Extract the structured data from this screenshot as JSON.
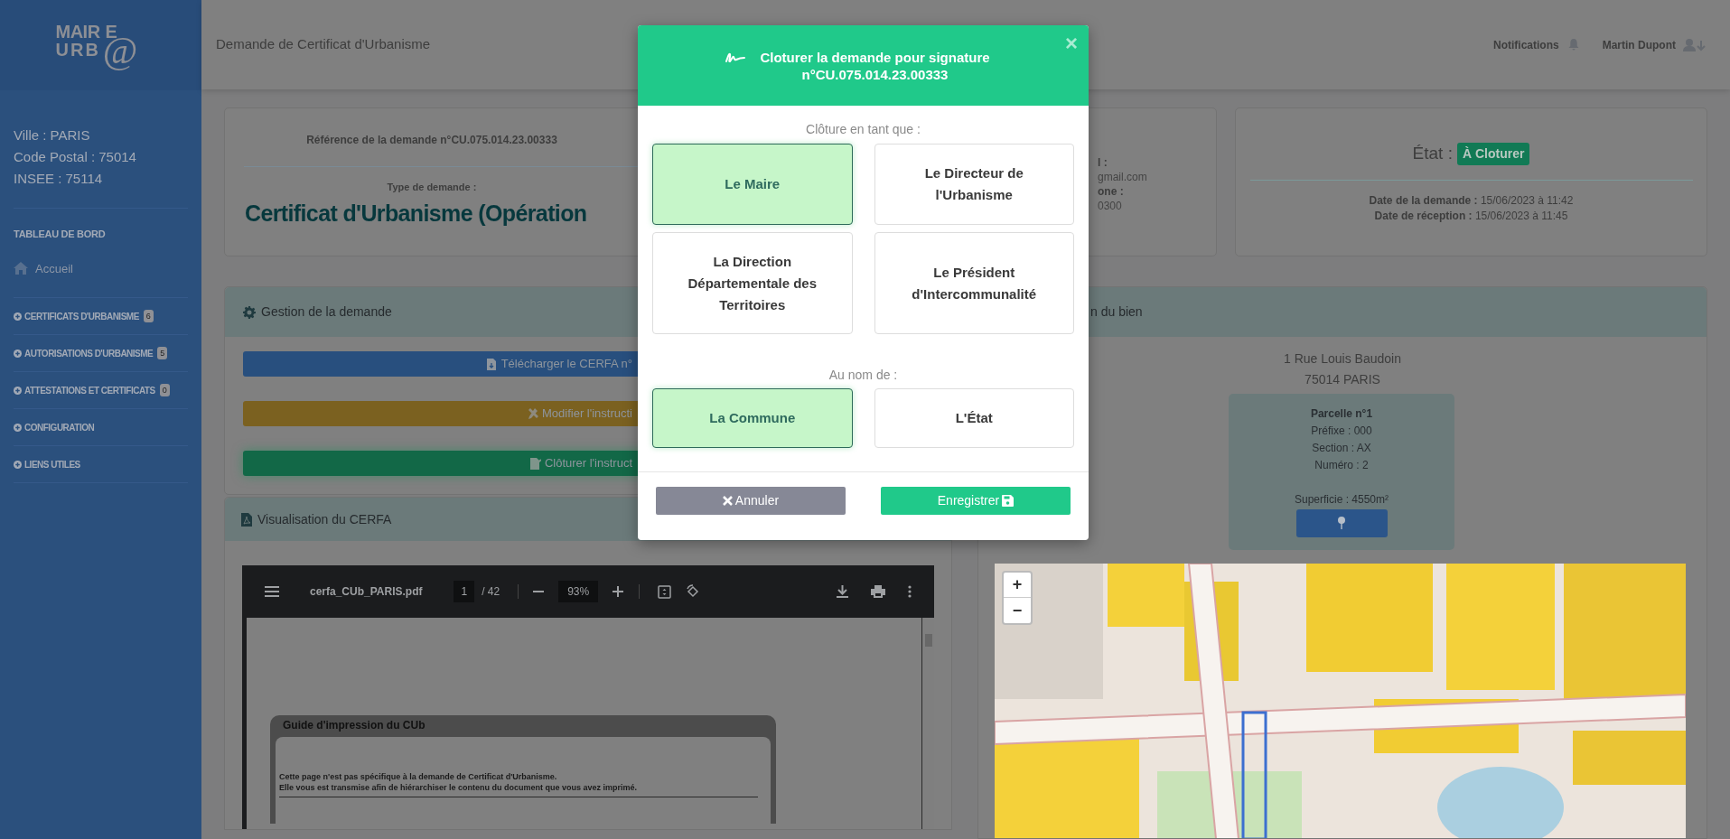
{
  "header": {
    "title": "Demande de Certificat d'Urbanisme",
    "notifications": "Notifications",
    "user": "Martin Dupont"
  },
  "logo": {
    "line_1": "MAIR",
    "line_1_end": "E",
    "line_2": "URB",
    "symbol": "@"
  },
  "sidebar": {
    "info": [
      "Ville : PARIS",
      "Code Postal : 75014",
      "INSEE : 75114"
    ],
    "section": "TABLEAU DE BORD",
    "home": "Accueil",
    "menu": [
      {
        "label": "CERTIFICATS D'URBANISME",
        "count": "6"
      },
      {
        "label": "AUTORISATIONS D'URBANISME",
        "count": "5"
      },
      {
        "label": "ATTESTATIONS ET CERTIFICATS",
        "count": "0"
      },
      {
        "label": "CONFIGURATION"
      },
      {
        "label": "LIENS UTILES"
      }
    ]
  },
  "reference_card": {
    "reference": "Référence de la demande n°CU.075.014.23.00333",
    "type_label": "Type de demande :",
    "type": "Certificat d'Urbanisme (Opération"
  },
  "contact_card": {
    "lines": [
      {
        "text": "l :",
        "kind": "label"
      },
      {
        "text": "gmail.com",
        "kind": "value"
      },
      {
        "text": "one :",
        "kind": "label"
      },
      {
        "text": "0300",
        "kind": "value"
      }
    ]
  },
  "status_card": {
    "label": "État :",
    "badge": "À Cloturer",
    "dates": [
      {
        "label": "Date de la demande :",
        "value": "15/06/2023 à 11:42"
      },
      {
        "label": "Date de réception :",
        "value": "15/06/2023 à 11:45"
      }
    ]
  },
  "management": {
    "title": "Gestion de la demande",
    "buttons": [
      {
        "label": "Télécharger le CERFA n°",
        "kind": "download"
      },
      {
        "label": "Modifier l'instructi",
        "kind": "edit"
      },
      {
        "label": "Clôturer l'instruct",
        "kind": "close"
      }
    ]
  },
  "cerfa": {
    "title": "Visualisation du CERFA",
    "viewer": {
      "file": "cerfa_CUb_PARIS.pdf",
      "page": "1",
      "pages": "/ 42",
      "zoom": "93%",
      "doc_heading": "Guide d'impression du CUb",
      "doc_text": [
        "Cette page n'est pas spécifique à la demande de Certificat d'Urbanisme.",
        "Elle vous est transmise afin de hiérarchiser le contenu du document que vous avez imprimé."
      ]
    }
  },
  "property": {
    "title": "n du bien",
    "address": [
      "1 Rue Louis Baudoin",
      "75014 PARIS"
    ],
    "parcel": {
      "title": "Parcelle n°1",
      "lines": [
        "Préfixe : 000",
        "Section : AX",
        "Numéro : 2"
      ],
      "area": "Superficie : 4550m²"
    },
    "map": {
      "zoom_in": "+",
      "zoom_out": "−"
    }
  },
  "modal": {
    "title": "Cloturer la demande pour signature n°CU.075.014.23.00333",
    "close": "×",
    "role_label": "Clôture en tant que :",
    "roles": [
      {
        "label": "Le Maire",
        "selected": true
      },
      {
        "label": "Le Directeur de l'Urbanisme",
        "selected": false
      },
      {
        "label": "La Direction Départementale des Territoires",
        "selected": false
      },
      {
        "label": "Le Président d'Intercommunalité",
        "selected": false
      }
    ],
    "on_behalf_label": "Au nom de :",
    "entities": [
      {
        "label": "La Commune",
        "selected": true
      },
      {
        "label": "L'État",
        "selected": false
      }
    ],
    "cancel": "Annuler",
    "save": "Enregistrer"
  }
}
